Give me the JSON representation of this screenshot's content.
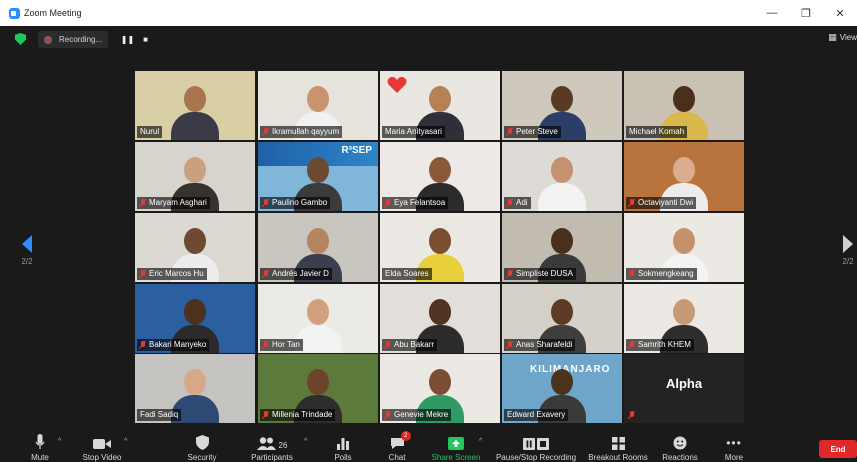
{
  "window": {
    "title": "Zoom Meeting",
    "controls": [
      "—",
      "❐",
      "✕"
    ]
  },
  "topbar": {
    "recording_label": "Recording...",
    "pause_icon": "❚❚",
    "stop_icon": "■",
    "view_label": "View"
  },
  "pagination": {
    "left_page": "2/2",
    "right_page": "2/2"
  },
  "participants": [
    {
      "name": "Nurul",
      "muted": false,
      "active": true,
      "bg": "#d8cfa6",
      "skin": "#a8754e",
      "shirt": "#3a3a48"
    },
    {
      "name": "Ikramullah qayyum",
      "muted": true,
      "bg": "#e6e3dd",
      "skin": "#c9936b",
      "shirt": "#f1f1f1"
    },
    {
      "name": "Maria Anityasari",
      "muted": false,
      "bg": "#eae6e2",
      "skin": "#b78157",
      "shirt": "#2f2f37"
    },
    {
      "name": "Peter Steve",
      "muted": true,
      "bg": "#cfc8bd",
      "skin": "#5b3a23",
      "shirt": "#2a3e68"
    },
    {
      "name": "Michael Komah",
      "muted": false,
      "bg": "#c9c2b4",
      "skin": "#4a2f1d",
      "shirt": "#d8b84a"
    },
    {
      "name": "Maryam Asghari",
      "muted": true,
      "bg": "#d7d3cd",
      "skin": "#caa17f",
      "shirt": "#36332f"
    },
    {
      "name": "Paulino Gambo",
      "muted": true,
      "bg": "#7fb6d9",
      "skin": "#6a4a33",
      "shirt": "#3b3b3b"
    },
    {
      "name": "Eya Felantsoa",
      "muted": true,
      "bg": "#ece9e6",
      "skin": "#8a5a3b",
      "shirt": "#2b2b2b"
    },
    {
      "name": "Adi",
      "muted": true,
      "bg": "#dedad5",
      "skin": "#c39271",
      "shirt": "#f3f3f3"
    },
    {
      "name": "Octaviyanti Dwi",
      "muted": true,
      "bg": "#b9733d",
      "skin": "#d9ad8d",
      "shirt": "#ececec"
    },
    {
      "name": "Eric Marcos Hu",
      "muted": true,
      "bg": "#dcd9d3",
      "skin": "#6d4a30",
      "shirt": "#ededed"
    },
    {
      "name": "Andrés Javier D",
      "muted": true,
      "bg": "#c9c5bf",
      "skin": "#b58460",
      "shirt": "#3a3f4d"
    },
    {
      "name": "Elda Soares",
      "muted": false,
      "bg": "#ece9e5",
      "skin": "#7a4f31",
      "shirt": "#e9cf3b"
    },
    {
      "name": "Simpliste DUSA",
      "muted": true,
      "bg": "#c2bbb0",
      "skin": "#4b2f1e",
      "shirt": "#3a3a3a"
    },
    {
      "name": "Sokmengkeang",
      "muted": true,
      "bg": "#ece9e5",
      "skin": "#c3916a",
      "shirt": "#f3f3f3"
    },
    {
      "name": "Bakari Manyeko",
      "muted": true,
      "bg": "#2c5fa0",
      "skin": "#4d301d",
      "shirt": "#2a2a2a"
    },
    {
      "name": "Hor Tan",
      "muted": true,
      "bg": "#eceae6",
      "skin": "#d2a07c",
      "shirt": "#f2f2f2"
    },
    {
      "name": "Abu Bakarr",
      "muted": true,
      "bg": "#e2dfda",
      "skin": "#4f321f",
      "shirt": "#2c2c2c"
    },
    {
      "name": "Anas Sharafeldi",
      "muted": true,
      "bg": "#d5d0c8",
      "skin": "#5c3b25",
      "shirt": "#3e3e3e"
    },
    {
      "name": "Samrith KHEM",
      "muted": true,
      "bg": "#ece9e5",
      "skin": "#c89a74",
      "shirt": "#2e2e2e"
    },
    {
      "name": "Fadi Sadiq",
      "muted": false,
      "bg": "#c5c3bf",
      "skin": "#d6a887",
      "shirt": "#2f4a72"
    },
    {
      "name": "Millenia Trindade",
      "muted": true,
      "bg": "#5c7a3c",
      "skin": "#6b442b",
      "shirt": "#2d2d2d"
    },
    {
      "name": "Genevie Mekre",
      "muted": true,
      "bg": "#ece9e5",
      "skin": "#7a4e30",
      "shirt": "#2f9a63"
    },
    {
      "name": "Edward Exavery",
      "muted": false,
      "bg": "#6ea6c9",
      "skin": "#4e3220",
      "shirt": "#3a3a3a"
    },
    {
      "name": "Alpha",
      "muted": true,
      "text_only": true
    }
  ],
  "stickers": {
    "rsep": "R³SEP",
    "kili": "KILIMANJARO"
  },
  "toolbar": {
    "mute": "Mute",
    "stop_video": "Stop Video",
    "security": "Security",
    "participants": "Participants",
    "participant_count": "26",
    "polls": "Polls",
    "chat": "Chat",
    "chat_badge": "2",
    "share_screen": "Share Screen",
    "recording": "Pause/Stop Recording",
    "breakout": "Breakout Rooms",
    "reactions": "Reactions",
    "more": "More",
    "end": "End"
  },
  "colors": {
    "accent": "#2d8cff",
    "active_speaker": "#c8e34a",
    "end": "#e02828",
    "share": "#22c55e"
  }
}
